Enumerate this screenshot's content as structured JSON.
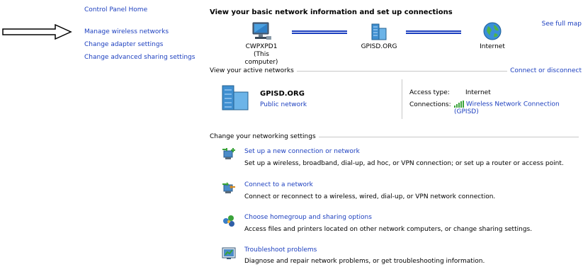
{
  "nav": {
    "items": [
      {
        "label": "Control Panel Home"
      },
      {
        "label": "Manage wireless networks"
      },
      {
        "label": "Change adapter settings"
      },
      {
        "label": "Change advanced sharing settings"
      }
    ]
  },
  "header": {
    "title": "View your basic network information and set up connections",
    "see_full_map": "See full map"
  },
  "map": {
    "computer_name": "CWPXPD1",
    "computer_sub": "(This computer)",
    "network_name": "GPISD.ORG",
    "internet_label": "Internet"
  },
  "active": {
    "section_label": "View your active networks",
    "connect_link": "Connect or disconnect",
    "network_name": "GPISD.ORG",
    "network_type": "Public network",
    "access_type_label": "Access type:",
    "access_type_value": "Internet",
    "connections_label": "Connections:",
    "connections_value": "Wireless Network Connection (GPISD)"
  },
  "settings": {
    "section_label": "Change your networking settings",
    "tasks": [
      {
        "title": "Set up a new connection or network",
        "desc": "Set up a wireless, broadband, dial-up, ad hoc, or VPN connection; or set up a router or access point.",
        "icon": "new-connection-icon"
      },
      {
        "title": "Connect to a network",
        "desc": "Connect or reconnect to a wireless, wired, dial-up, or VPN network connection.",
        "icon": "connect-network-icon"
      },
      {
        "title": "Choose homegroup and sharing options",
        "desc": "Access files and printers located on other network computers, or change sharing settings.",
        "icon": "homegroup-icon"
      },
      {
        "title": "Troubleshoot problems",
        "desc": "Diagnose and repair network problems, or get troubleshooting information.",
        "icon": "troubleshoot-icon"
      }
    ]
  },
  "colors": {
    "link": "#1c3fbf",
    "rule": "#c8c8c8"
  }
}
